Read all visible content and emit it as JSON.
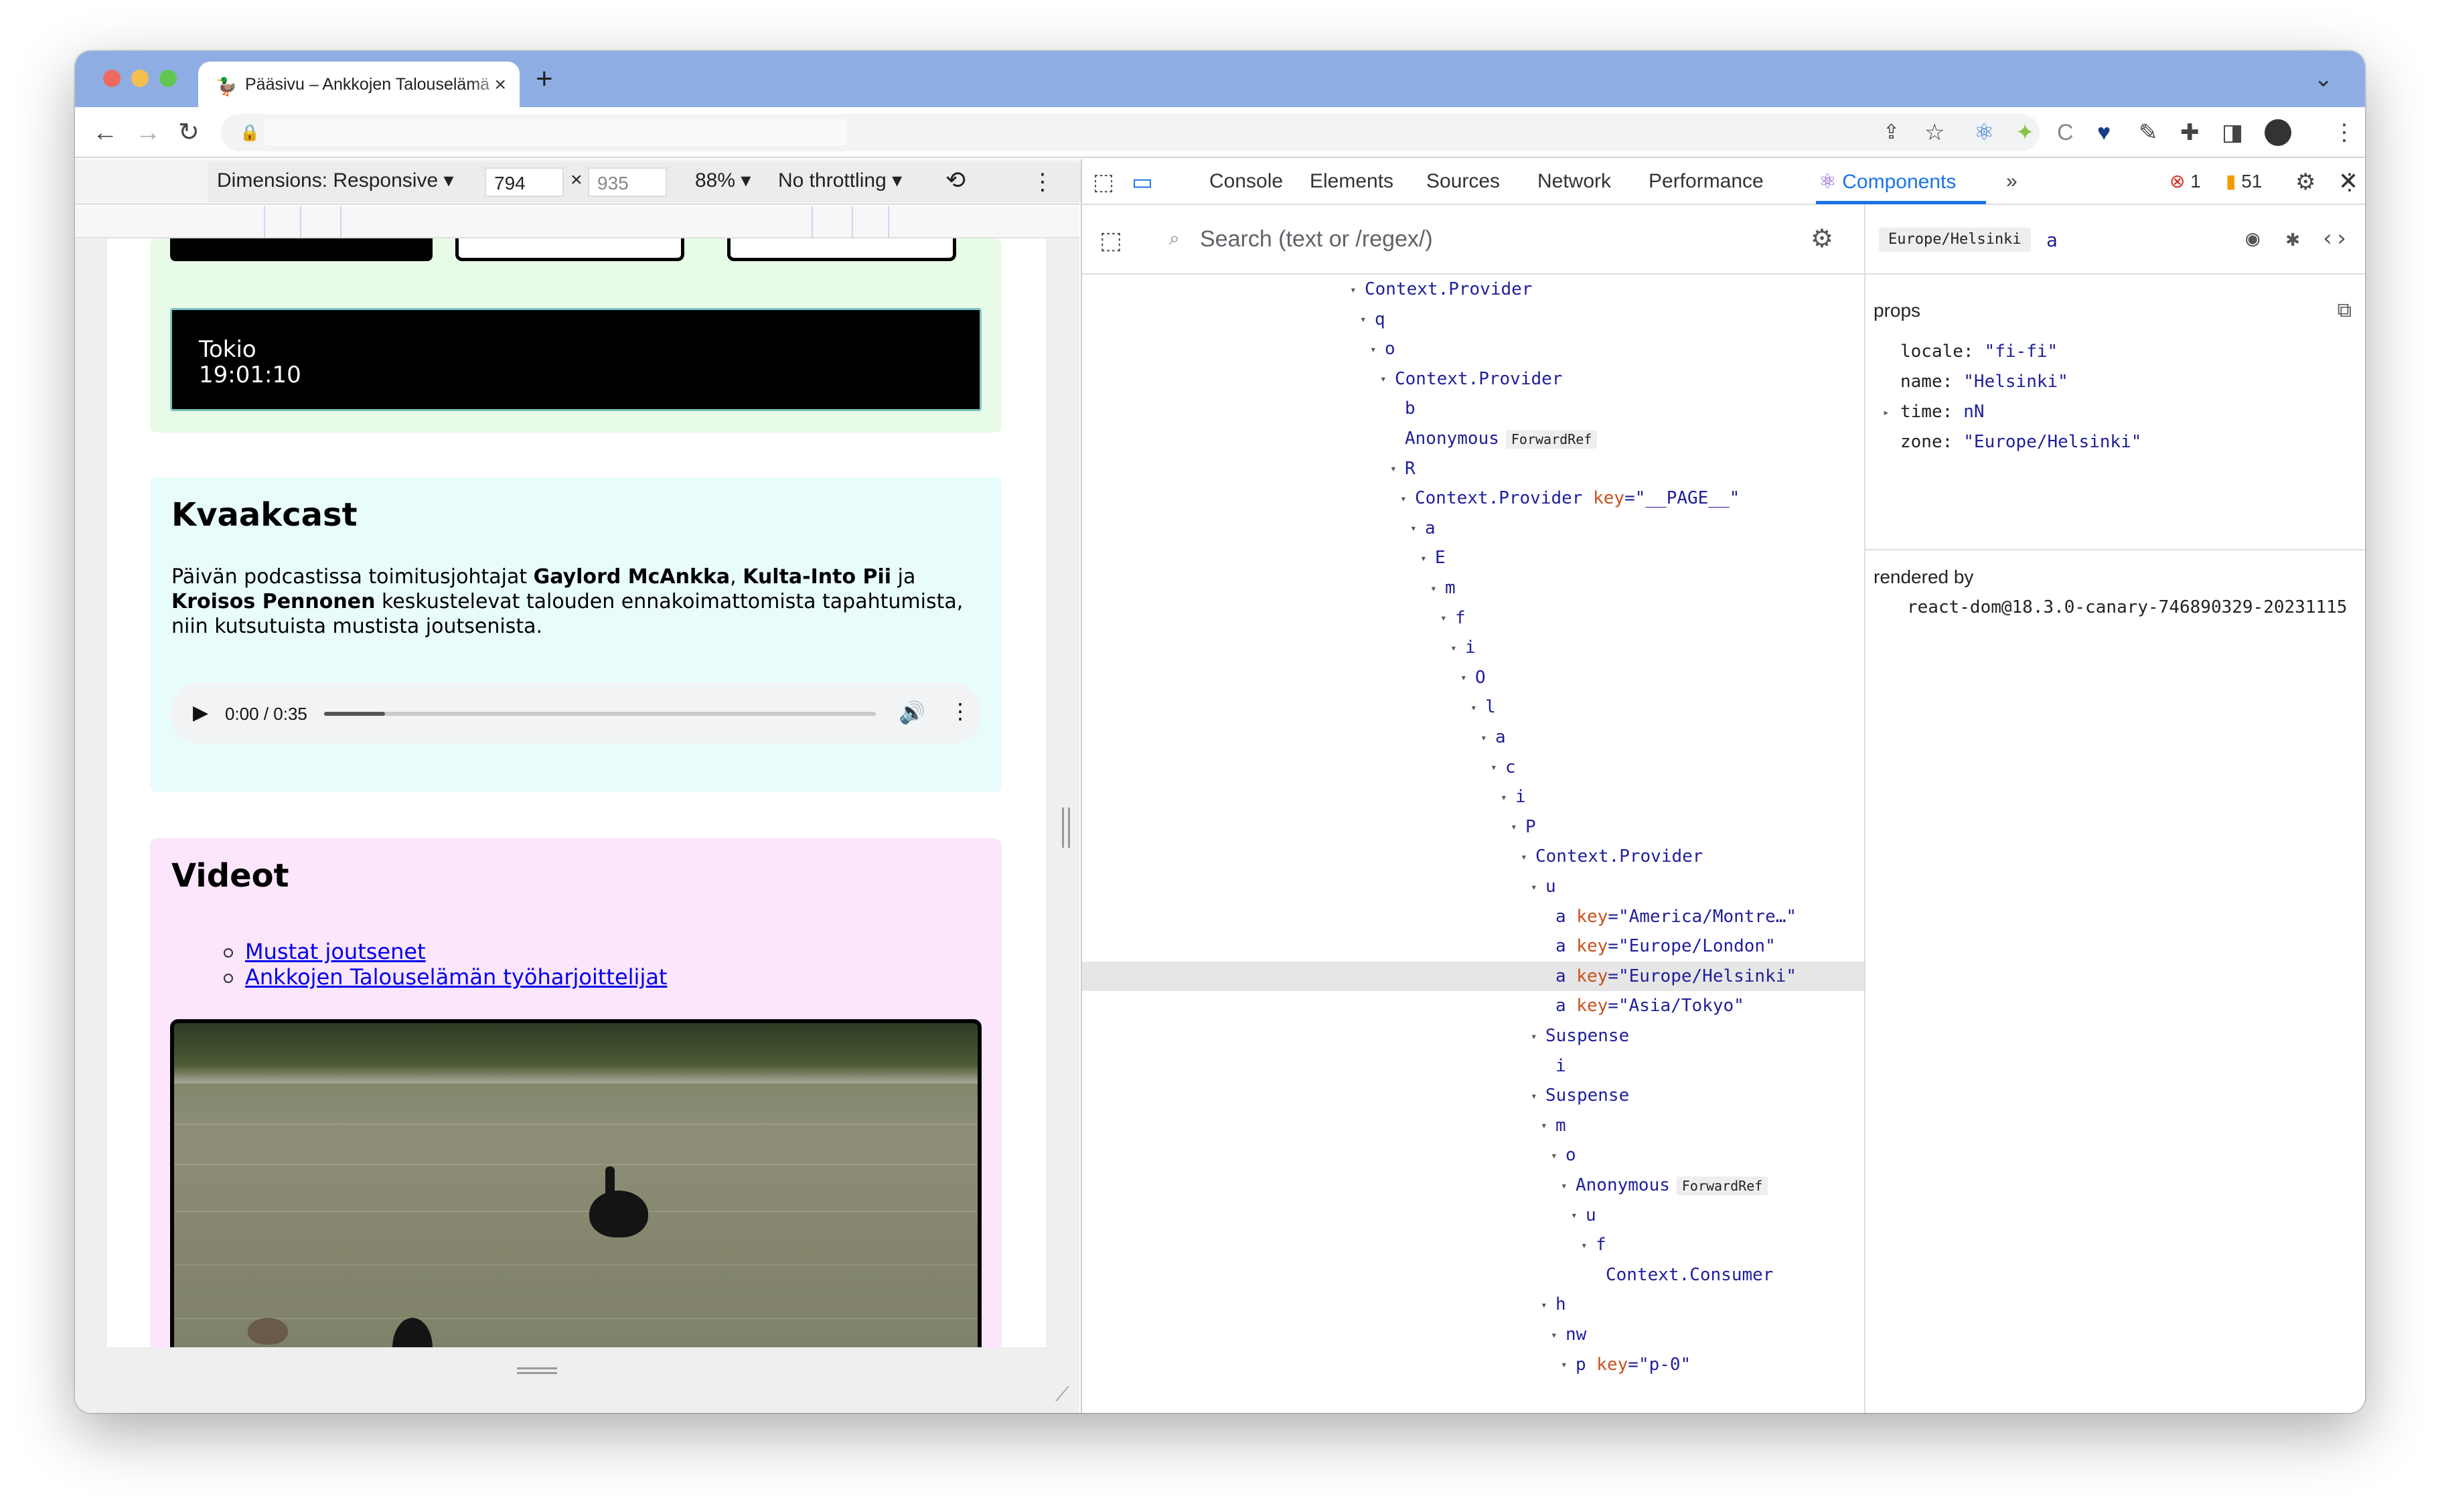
{
  "browser": {
    "tab_title": "Pääsivu – Ankkojen Talouselämä",
    "tab_favicon": "duck-icon",
    "toolbar_icons": [
      "share-icon",
      "bookmark-star-icon",
      "react-devtools-icon",
      "extension-icon",
      "extension-icon",
      "extension-icon",
      "pen-icon",
      "puzzle-icon",
      "sidebar-icon",
      "avatar",
      "kebab-menu-icon"
    ]
  },
  "device_toolbar": {
    "dimensions_label": "Dimensions: Responsive",
    "width": "794",
    "height": "935",
    "zoom": "88%",
    "throttling": "No throttling"
  },
  "page": {
    "clock_city": "Tokio",
    "clock_time": "19:01:10",
    "podcast_title": "Kvaakcast",
    "podcast_text_1": "Päivän podcastissa toimitusjohtajat ",
    "podcast_host_1": "Gaylord McAnkka",
    "podcast_sep_1": ", ",
    "podcast_host_2": "Kulta-Into Pii",
    "podcast_sep_2": " ja ",
    "podcast_host_3": "Kroisos Pennonen",
    "podcast_text_2": " keskustelevat talouden ennakoimattomista tapahtumista, niin kutsutuista mustista joutsenista.",
    "audio_time": "0:00 / 0:35",
    "audio_progress": 0.11,
    "videos_title": "Videot",
    "video_links": [
      "Mustat joutsenet",
      "Ankkojen Talouselämän työharjoittelijat"
    ]
  },
  "devtools": {
    "tabs": [
      "Console",
      "Elements",
      "Sources",
      "Network",
      "Performance",
      "Components"
    ],
    "active_tab": "Components",
    "error_count": "1",
    "warning_count": "51",
    "search_placeholder": "Search (text or /regex/)",
    "tree": [
      {
        "depth": 0,
        "arrow": true,
        "name": "Context.Provider"
      },
      {
        "depth": 1,
        "arrow": true,
        "name": "q"
      },
      {
        "depth": 2,
        "arrow": true,
        "name": "o"
      },
      {
        "depth": 3,
        "arrow": true,
        "name": "Context.Provider"
      },
      {
        "depth": 4,
        "arrow": false,
        "name": "b"
      },
      {
        "depth": 4,
        "arrow": false,
        "name": "Anonymous",
        "badge": "ForwardRef"
      },
      {
        "depth": 4,
        "arrow": true,
        "name": "R"
      },
      {
        "depth": 5,
        "arrow": true,
        "name": "Context.Provider",
        "key": "\"__PAGE__\""
      },
      {
        "depth": 6,
        "arrow": true,
        "name": "a"
      },
      {
        "depth": 7,
        "arrow": true,
        "name": "E"
      },
      {
        "depth": 8,
        "arrow": true,
        "name": "m"
      },
      {
        "depth": 9,
        "arrow": true,
        "name": "f"
      },
      {
        "depth": 10,
        "arrow": true,
        "name": "i"
      },
      {
        "depth": 11,
        "arrow": true,
        "name": "O"
      },
      {
        "depth": 12,
        "arrow": true,
        "name": "l"
      },
      {
        "depth": 13,
        "arrow": true,
        "name": "a"
      },
      {
        "depth": 14,
        "arrow": true,
        "name": "c"
      },
      {
        "depth": 15,
        "arrow": true,
        "name": "i"
      },
      {
        "depth": 16,
        "arrow": true,
        "name": "P"
      },
      {
        "depth": 17,
        "arrow": true,
        "name": "Context.Provider"
      },
      {
        "depth": 18,
        "arrow": true,
        "name": "u"
      },
      {
        "depth": 19,
        "arrow": false,
        "name": "a",
        "key": "\"America/Montre…\""
      },
      {
        "depth": 19,
        "arrow": false,
        "name": "a",
        "key": "\"Europe/London\""
      },
      {
        "depth": 19,
        "arrow": false,
        "name": "a",
        "key": "\"Europe/Helsinki\"",
        "selected": true
      },
      {
        "depth": 19,
        "arrow": false,
        "name": "a",
        "key": "\"Asia/Tokyo\""
      },
      {
        "depth": 18,
        "arrow": true,
        "name": "Suspense"
      },
      {
        "depth": 19,
        "arrow": false,
        "name": "i"
      },
      {
        "depth": 18,
        "arrow": true,
        "name": "Suspense"
      },
      {
        "depth": 19,
        "arrow": true,
        "name": "m"
      },
      {
        "depth": 20,
        "arrow": true,
        "name": "o"
      },
      {
        "depth": 21,
        "arrow": true,
        "name": "Anonymous",
        "badge": "ForwardRef"
      },
      {
        "depth": 22,
        "arrow": true,
        "name": "u"
      },
      {
        "depth": 23,
        "arrow": true,
        "name": "f"
      },
      {
        "depth": 24,
        "arrow": false,
        "name": "Context.Consumer"
      },
      {
        "depth": 19,
        "arrow": true,
        "name": "h"
      },
      {
        "depth": 20,
        "arrow": true,
        "name": "nw"
      },
      {
        "depth": 21,
        "arrow": true,
        "name": "p",
        "key": "\"p-0\""
      }
    ],
    "selected_key_pill": "Europe/Helsinki",
    "selected_component": "a",
    "props_label": "props",
    "props": [
      {
        "k": "locale:",
        "v": "\"fi-fi\"",
        "arrow": false
      },
      {
        "k": "name:",
        "v": "\"Helsinki\"",
        "arrow": false
      },
      {
        "k": "time:",
        "v": "nN",
        "arrow": true
      },
      {
        "k": "zone:",
        "v": "\"Europe/Helsinki\"",
        "arrow": false
      }
    ],
    "rendered_by_label": "rendered by",
    "rendered_by_value": "react-dom@18.3.0-canary-746890329-20231115"
  },
  "colors": {
    "accent": "#1a73e8",
    "tree_text": "#1f1f9a",
    "key_text": "#c8501e"
  }
}
